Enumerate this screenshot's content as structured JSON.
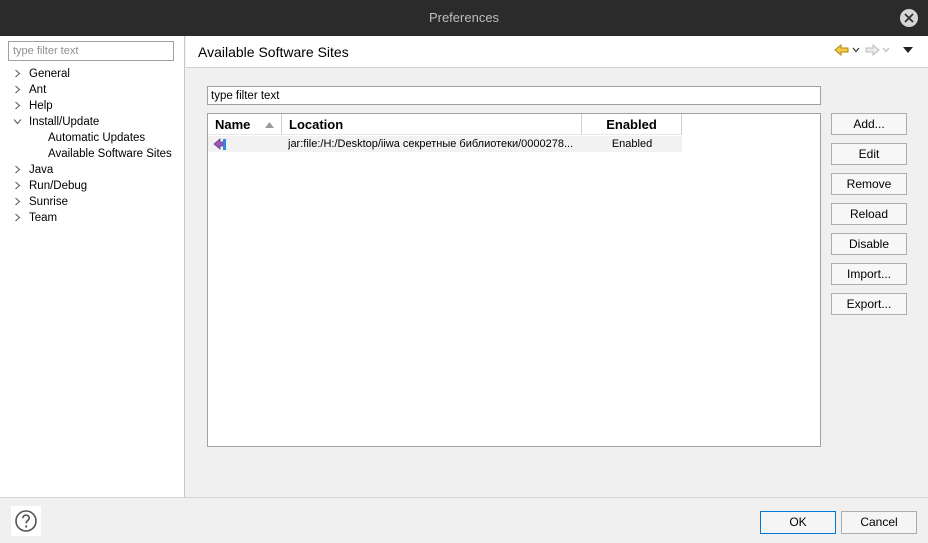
{
  "window": {
    "title": "Preferences"
  },
  "left_pane": {
    "filter_placeholder": "type filter text",
    "tree": [
      {
        "label": "General",
        "expanded": false
      },
      {
        "label": "Ant",
        "expanded": false
      },
      {
        "label": "Help",
        "expanded": false
      },
      {
        "label": "Install/Update",
        "expanded": true
      },
      {
        "label": "Automatic Updates",
        "child": true
      },
      {
        "label": "Available Software Sites",
        "child": true,
        "selected": true
      },
      {
        "label": "Java",
        "expanded": false
      },
      {
        "label": "Run/Debug",
        "expanded": false
      },
      {
        "label": "Sunrise",
        "expanded": false
      },
      {
        "label": "Team",
        "expanded": false
      }
    ]
  },
  "page": {
    "title": "Available Software Sites",
    "filter_value": "type filter text",
    "table": {
      "columns": [
        "Name",
        "Location",
        "Enabled"
      ],
      "sort_column": "Name",
      "rows": [
        {
          "name": "",
          "location": "jar:file:/H:/Desktop/iiwa секретные библиотеки/0000278...",
          "enabled": "Enabled"
        }
      ]
    },
    "buttons": [
      "Add...",
      "Edit",
      "Remove",
      "Reload",
      "Disable",
      "Import...",
      "Export..."
    ]
  },
  "footer": {
    "ok_label": "OK",
    "cancel_label": "Cancel"
  },
  "icons": {
    "close": "close-icon",
    "back": "back-arrow-icon",
    "forward": "forward-arrow-icon",
    "menu": "view-menu-icon",
    "help": "help-icon",
    "site": "site-icon"
  },
  "colors": {
    "titlebar": "#2b2b2b",
    "focus_border": "#0078d7",
    "back_arrow": "#e0b42a"
  }
}
